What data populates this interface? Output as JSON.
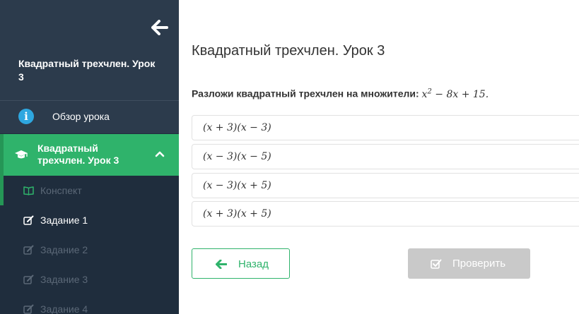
{
  "sidebar": {
    "course_title": "Квадратный трехчлен. Урок 3",
    "overview_label": "Обзор урока",
    "active_lesson_label": "Квадратный трехчлен. Урок 3",
    "items": [
      {
        "label": "Конспект",
        "icon": "book-icon",
        "state": "muted"
      },
      {
        "label": "Задание 1",
        "icon": "edit-icon",
        "state": "active"
      },
      {
        "label": "Задание 2",
        "icon": "edit-icon",
        "state": "muted"
      },
      {
        "label": "Задание 3",
        "icon": "edit-icon",
        "state": "muted"
      },
      {
        "label": "Задание 4",
        "icon": "edit-icon",
        "state": "muted"
      }
    ]
  },
  "main": {
    "title": "Квадратный трехчлен. Урок 3",
    "question_text": "Разложи квадратный трехчлен на множители: ",
    "question_math_base": "x",
    "question_math_exp": "2",
    "question_math_rest": " − 8x + 15.",
    "options": [
      "(x + 3)(x − 3)",
      "(x − 3)(x − 5)",
      "(x − 3)(x + 5)",
      "(x + 3)(x + 5)"
    ],
    "back_label": "Назад",
    "check_label": "Проверить"
  },
  "colors": {
    "sidebar_bg": "#1f2d3d",
    "sidebar_header_bg": "#2c3b4c",
    "accent_green": "#2fb36b",
    "info_blue": "#2ea7e0",
    "disabled_gray": "#c9c9c9"
  }
}
